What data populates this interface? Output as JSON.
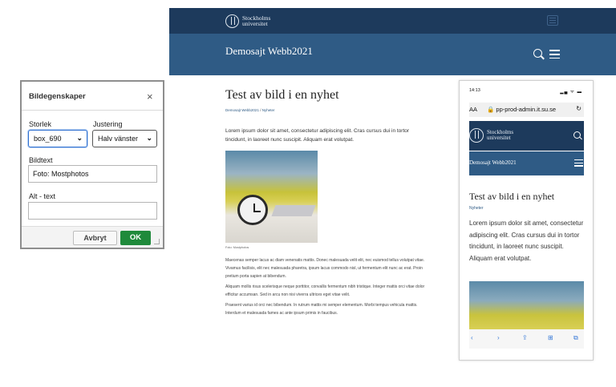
{
  "site": {
    "logo_line1": "Stockholms",
    "logo_line2": "universitet",
    "site_title": "Demosajt Webb2021",
    "article_title": "Test av bild i en nyhet",
    "breadcrumb_home": "Demosajt Webb2021",
    "breadcrumb_sep": "/",
    "breadcrumb_current": "Nyheter",
    "lead": "Lorem ipsum dolor sit amet, consectetur adipiscing elit. Cras cursus dui in tortor tincidunt, in laoreet nunc suscipit. Aliquam erat volutpat.",
    "image_caption": "Foto: Mostphotos",
    "paragraphs": [
      "Maecenas semper lacus ac diam venenatis mattis. Donec malesuada velit elit, nec euismod tellus volutpat vitae. Vivamus facilisis, elit nec malesuada pharetra, ipsum lacus commodo nisl, ut fermentum elit nunc ac erat. Proin pretium porta sapien at bibendum.",
      "Aliquam mollis risus scelerisque neque porttitor, convallis fermentum nibh tristique. Integer mattis orci vitae dolor efficitur accumsan. Sed in arcu non nisi viverra ultrices eget vitae velit.",
      "Praesent varius id orci nec bibendum. In rutrum mattis mi semper elementum. Morbi tempus vehicula mattis. Interdum et malesuada fames ac ante ipsum primis in faucibus."
    ]
  },
  "phone": {
    "time": "14:13",
    "status_icons": "▂▄ ᯤ ▬",
    "aa": "AA",
    "url": "🔒 pp-prod-admin.it.su.se",
    "reload": "↻",
    "logo_line1": "Stockholms",
    "logo_line2": "universitet",
    "site_title": "Demosajt Webb2021",
    "article_title": "Test av bild i en nyhet",
    "breadcrumb": "Nyheter",
    "lead": "Lorem ipsum dolor sit amet, consectetur adipiscing elit. Cras cursus dui in tortor tincidunt, in laoreet nunc suscipit. Aliquam erat volutpat.",
    "toolbar": [
      "‹",
      "›",
      "⇪",
      "⊞",
      "⧉"
    ]
  },
  "dialog": {
    "title": "Bildegenskaper",
    "close": "×",
    "size_label": "Storlek",
    "size_value": "box_690",
    "align_label": "Justering",
    "align_value": "Halv vänster",
    "caption_label": "Bildtext",
    "caption_value": "Foto: Mostphotos",
    "alt_label": "Alt - text",
    "alt_value": "",
    "cancel_label": "Avbryt",
    "ok_label": "OK"
  },
  "colors": {
    "header_dark": "#1d3a5c",
    "header_blue": "#2f5b85",
    "ok_green": "#1f8a3b",
    "focus_blue": "#2d6fd1"
  }
}
